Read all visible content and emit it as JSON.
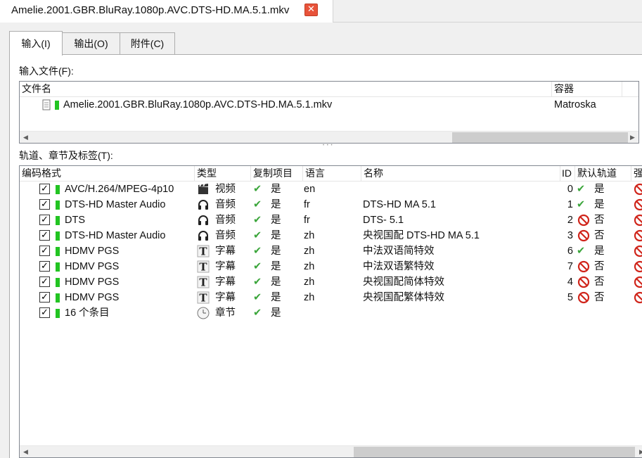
{
  "window": {
    "doc_tab_title": "Amelie.2001.GBR.BluRay.1080p.AVC.DTS-HD.MA.5.1.mkv",
    "close_glyph": "✕"
  },
  "tabs": [
    {
      "label": "输入(I)",
      "active": true
    },
    {
      "label": "输出(O)",
      "active": false
    },
    {
      "label": "附件(C)",
      "active": false
    }
  ],
  "input_files": {
    "label": "输入文件(F):",
    "columns": [
      "文件名",
      "容器"
    ],
    "rows": [
      {
        "name": "Amelie.2001.GBR.BluRay.1080p.AVC.DTS-HD.MA.5.1.mkv",
        "container": "Matroska",
        "icon": "file-icon"
      }
    ]
  },
  "tracks": {
    "label": "轨道、章节及标签(T):",
    "columns": [
      "编码格式",
      "类型",
      "复制项目",
      "语言",
      "名称",
      "ID",
      "默认轨道",
      "强"
    ],
    "rows": [
      {
        "codec": "AVC/H.264/MPEG-4p10",
        "type_icon": "video-icon",
        "type": "视频",
        "copy": "是",
        "lang": "en",
        "name": "",
        "id": "0",
        "default": "是",
        "default_yes": true
      },
      {
        "codec": "DTS-HD Master Audio",
        "type_icon": "headphones-icon",
        "type": "音频",
        "copy": "是",
        "lang": "fr",
        "name": "DTS-HD MA 5.1",
        "id": "1",
        "default": "是",
        "default_yes": true
      },
      {
        "codec": "DTS",
        "type_icon": "headphones-icon",
        "type": "音频",
        "copy": "是",
        "lang": "fr",
        "name": "DTS- 5.1",
        "id": "2",
        "default": "否",
        "default_yes": false
      },
      {
        "codec": "DTS-HD Master Audio",
        "type_icon": "headphones-icon",
        "type": "音频",
        "copy": "是",
        "lang": "zh",
        "name": "央视国配 DTS-HD MA 5.1",
        "id": "3",
        "default": "否",
        "default_yes": false
      },
      {
        "codec": "HDMV PGS",
        "type_icon": "subtitle-icon",
        "type": "字幕",
        "copy": "是",
        "lang": "zh",
        "name": "中法双语简特效",
        "id": "6",
        "default": "是",
        "default_yes": true
      },
      {
        "codec": "HDMV PGS",
        "type_icon": "subtitle-icon",
        "type": "字幕",
        "copy": "是",
        "lang": "zh",
        "name": "中法双语繁特效",
        "id": "7",
        "default": "否",
        "default_yes": false
      },
      {
        "codec": "HDMV PGS",
        "type_icon": "subtitle-icon",
        "type": "字幕",
        "copy": "是",
        "lang": "zh",
        "name": "央视国配简体特效",
        "id": "4",
        "default": "否",
        "default_yes": false
      },
      {
        "codec": "HDMV PGS",
        "type_icon": "subtitle-icon",
        "type": "字幕",
        "copy": "是",
        "lang": "zh",
        "name": "央视国配繁体特效",
        "id": "5",
        "default": "否",
        "default_yes": false
      },
      {
        "codec": "16 个条目",
        "type_icon": "clock-icon",
        "type": "章节",
        "copy": "是",
        "lang": "",
        "name": "",
        "id": "",
        "default": "",
        "default_yes": null
      }
    ]
  },
  "glyphs": {
    "checkmark": "✔",
    "checkbox_mark": "✓",
    "no_symbol": "⃠"
  },
  "colors": {
    "yes_green": "#3aa53a",
    "no_red": "#d0251b",
    "track_bar": "#22c422",
    "close_red": "#e8533a"
  }
}
